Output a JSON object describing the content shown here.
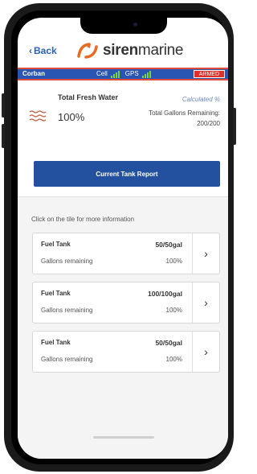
{
  "header": {
    "back_label": "Back",
    "brand_bold": "siren",
    "brand_light": "marine"
  },
  "status_bar": {
    "boat_name": "Corban",
    "cell_label": "Cell",
    "gps_label": "GPS",
    "armed_label": "ARMED",
    "colors": {
      "bar": "#2a56b3",
      "accent": "#e14b3a",
      "armed": "#e0302a",
      "signal": "#7cd63b"
    }
  },
  "water": {
    "title": "Total Fresh Water",
    "percent": "100%",
    "calc_label": "Calculated %",
    "gallons_label": "Total Gallons Remaining:",
    "gallons_value": "200/200",
    "icon": "water-waves-icon"
  },
  "report_button": {
    "label": "Current Tank Report"
  },
  "list": {
    "hint": "Click on the tile for more information",
    "tanks": [
      {
        "name": "Fuel Tank",
        "capacity": "50/50gal",
        "sub_label": "Gallons remaining",
        "percent": "100%"
      },
      {
        "name": "Fuel Tank",
        "capacity": "100/100gal",
        "sub_label": "Gallons remaining",
        "percent": "100%"
      },
      {
        "name": "Fuel Tank",
        "capacity": "50/50gal",
        "sub_label": "Gallons remaining",
        "percent": "100%"
      }
    ]
  }
}
